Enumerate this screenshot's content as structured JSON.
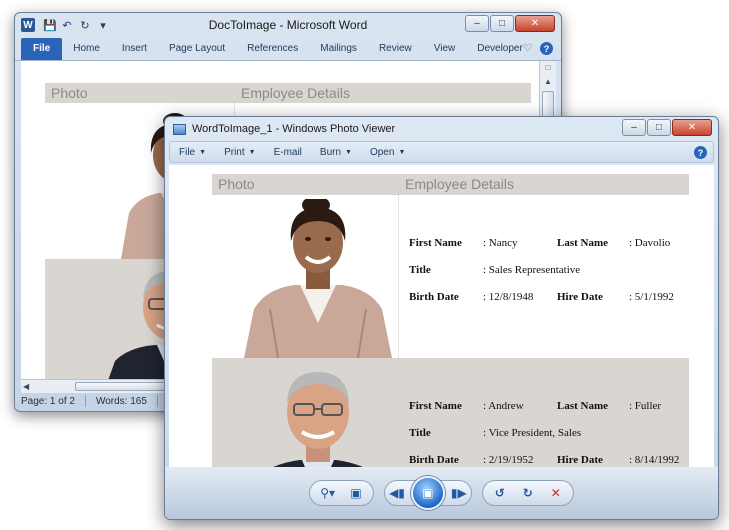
{
  "word": {
    "title": "DocToImage - Microsoft Word",
    "app_icon": "W",
    "ribbon_tabs": [
      "File",
      "Home",
      "Insert",
      "Page Layout",
      "References",
      "Mailings",
      "Review",
      "View",
      "Developer"
    ],
    "table_headers": {
      "photo": "Photo",
      "details": "Employee Details"
    },
    "status": {
      "page": "Page: 1 of 2",
      "words": "Words: 165"
    }
  },
  "viewer": {
    "title": "WordToImage_1 - Windows Photo Viewer",
    "menu": [
      {
        "label": "File",
        "has_caret": true
      },
      {
        "label": "Print",
        "has_caret": true
      },
      {
        "label": "E-mail",
        "has_caret": false
      },
      {
        "label": "Burn",
        "has_caret": true
      },
      {
        "label": "Open",
        "has_caret": true
      }
    ],
    "table_headers": {
      "photo": "Photo",
      "details": "Employee Details"
    },
    "employees": [
      {
        "first_name_label": "First Name",
        "first_name": ": Nancy",
        "last_name_label": "Last Name",
        "last_name": ": Davolio",
        "title_label": "Title",
        "title": ": Sales Representative",
        "birth_label": "Birth Date",
        "birth": ": 12/8/1948",
        "hire_label": "Hire Date",
        "hire": ": 5/1/1992"
      },
      {
        "first_name_label": "First Name",
        "first_name": ": Andrew",
        "last_name_label": "Last Name",
        "last_name": ": Fuller",
        "title_label": "Title",
        "title": ": Vice President, Sales",
        "birth_label": "Birth Date",
        "birth": ": 2/19/1952",
        "hire_label": "Hire Date",
        "hire": ": 8/14/1992"
      }
    ]
  },
  "colors": {
    "table_header_bg": "#d9d6d1",
    "accent_blue": "#2457a4",
    "close_red": "#c8432f",
    "delete_red": "#d02828"
  },
  "icons": [
    "zoom-icon",
    "fit-window-icon",
    "previous-icon",
    "slideshow-icon",
    "next-icon",
    "rotate-ccw-icon",
    "rotate-cw-icon",
    "delete-icon",
    "help-icon"
  ]
}
